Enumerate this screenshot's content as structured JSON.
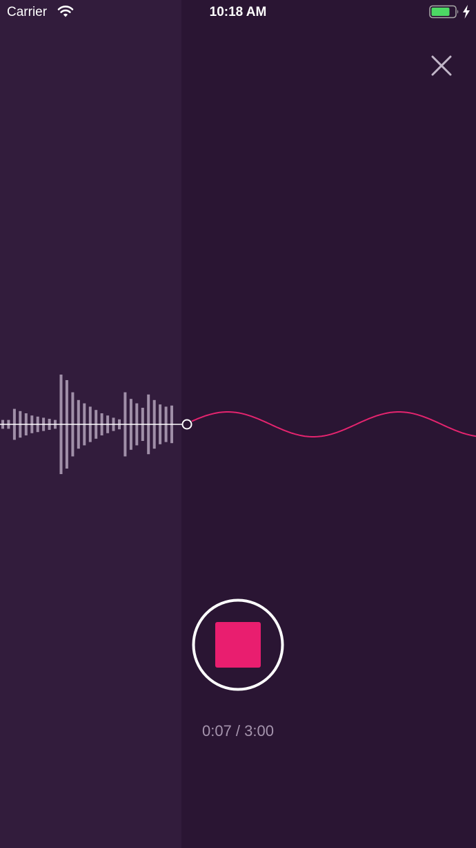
{
  "status_bar": {
    "carrier": "Carrier",
    "time": "10:18 AM",
    "wifi_icon": "wifi-icon",
    "battery_icon": "battery-icon",
    "charging_icon": "charging-bolt-icon"
  },
  "close_button": {
    "icon": "close-icon"
  },
  "recording": {
    "elapsed": "0:07",
    "total": "3:00",
    "timer_text": "0:07 / 3:00",
    "progress": 0.039,
    "amplitudes": [
      0.08,
      0.08,
      0.28,
      0.24,
      0.2,
      0.16,
      0.14,
      0.12,
      0.1,
      0.08,
      0.9,
      0.8,
      0.58,
      0.44,
      0.38,
      0.32,
      0.26,
      0.2,
      0.16,
      0.12,
      0.09,
      0.58,
      0.46,
      0.38,
      0.3,
      0.54,
      0.44,
      0.36,
      0.32,
      0.34
    ]
  },
  "colors": {
    "background": "#2a1533",
    "recorded_background": "#321c3c",
    "bars": "#a08fa8",
    "wave": "#e5246f",
    "stop": "#e91e6f"
  }
}
